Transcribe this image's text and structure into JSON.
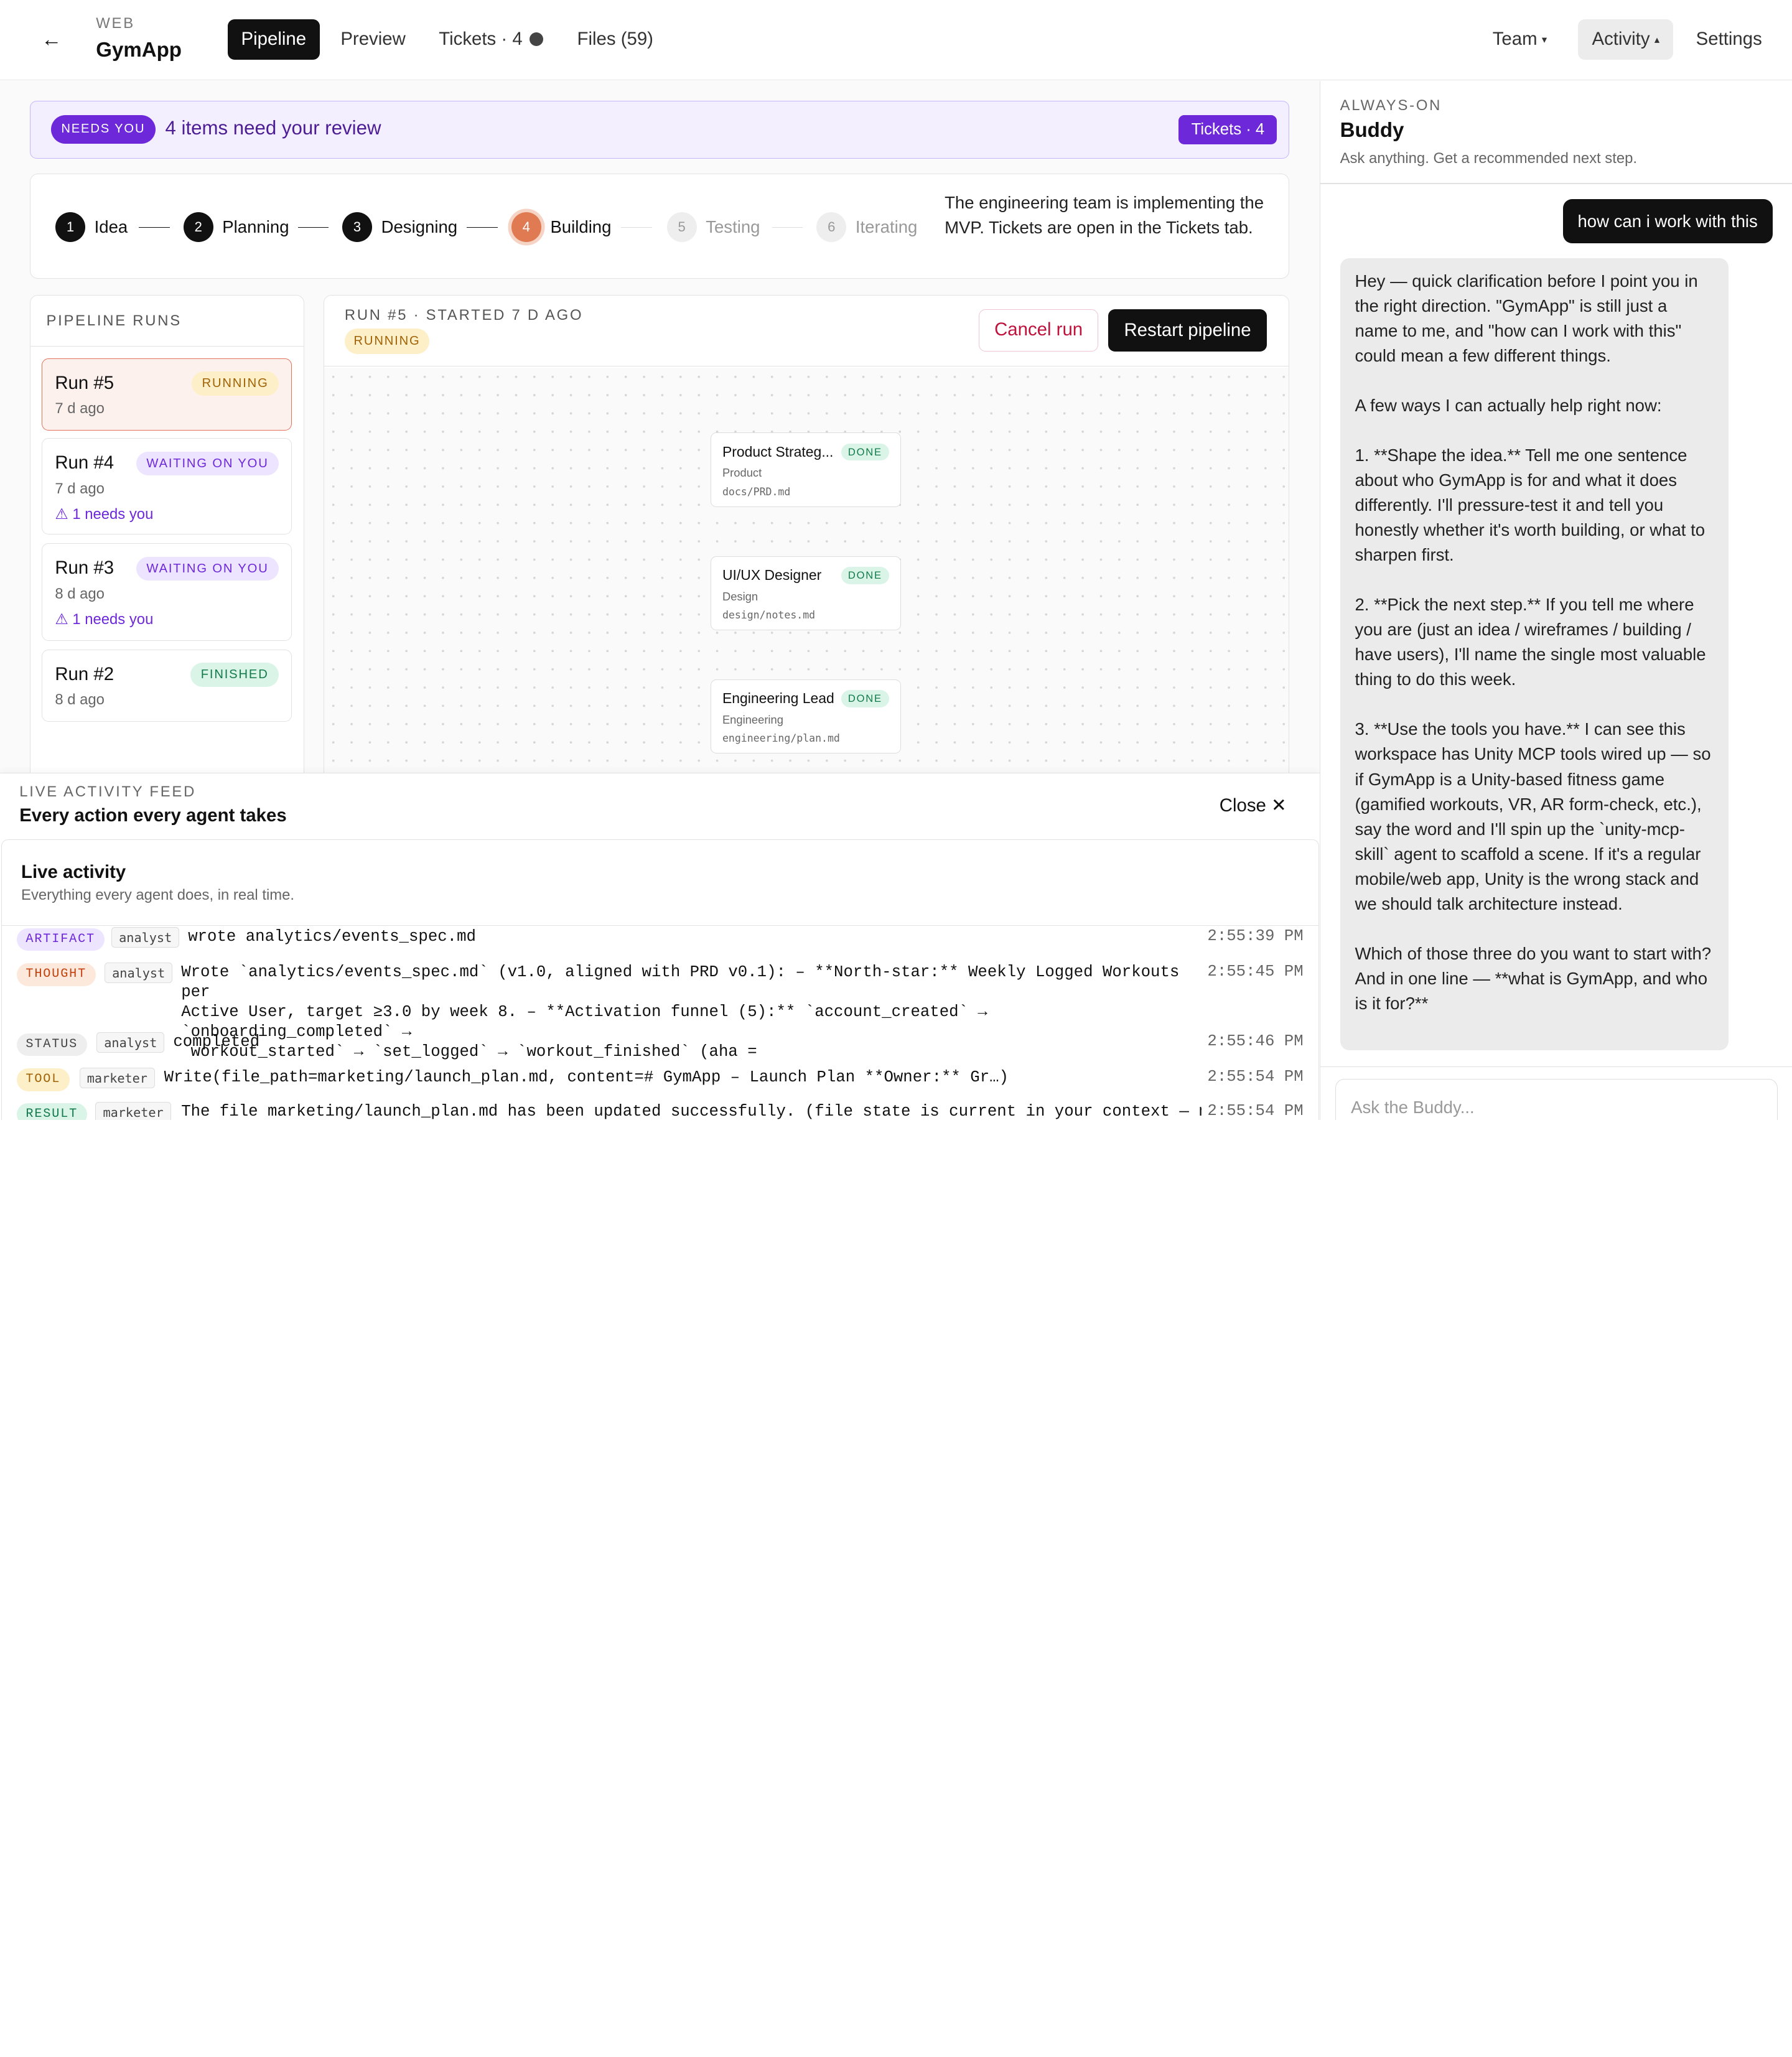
{
  "topbar": {
    "back_icon": "←",
    "app_kicker": "WEB",
    "app_name": "GymApp",
    "tabs": [
      {
        "label": "Pipeline",
        "active": true
      },
      {
        "label": "Preview"
      },
      {
        "label": "Tickets · 4"
      },
      {
        "label": "Files (59)"
      }
    ],
    "right": {
      "team": "Team",
      "team_caret": "▾",
      "activity": "Activity",
      "activity_caret": "▴",
      "settings": "Settings"
    }
  },
  "banner": {
    "badge": "NEEDS YOU",
    "text": "4 items need your review",
    "button": "Tickets · 4"
  },
  "stages": {
    "items": [
      {
        "num": "1",
        "label": "Idea"
      },
      {
        "num": "2",
        "label": "Planning"
      },
      {
        "num": "3",
        "label": "Designing"
      },
      {
        "num": "4",
        "label": "Building"
      },
      {
        "num": "5",
        "label": "Testing"
      },
      {
        "num": "6",
        "label": "Iterating"
      }
    ],
    "description": "The engineering team is implementing the MVP. Tickets are open in the Tickets tab."
  },
  "runs": {
    "title": "PIPELINE RUNS",
    "items": [
      {
        "name": "Run #5",
        "status": "RUNNING",
        "when": "7 d ago",
        "need": ""
      },
      {
        "name": "Run #4",
        "status": "WAITING ON YOU",
        "when": "7 d ago",
        "need": "⚠ 1 needs you"
      },
      {
        "name": "Run #3",
        "status": "WAITING ON YOU",
        "when": "8 d ago",
        "need": "⚠ 1 needs you"
      },
      {
        "name": "Run #2",
        "status": "FINISHED",
        "when": "8 d ago",
        "need": ""
      }
    ]
  },
  "canvas": {
    "meta": "RUN #5 · STARTED 7 D AGO",
    "status": "RUNNING",
    "cancel": "Cancel run",
    "restart": "Restart pipeline",
    "nodes": [
      {
        "title": "Product Strateg...",
        "badge": "DONE",
        "role": "Product",
        "file": "docs/PRD.md"
      },
      {
        "title": "UI/UX Designer",
        "badge": "DONE",
        "role": "Design",
        "file": "design/notes.md"
      },
      {
        "title": "Engineering Lead",
        "badge": "DONE",
        "role": "Engineering",
        "file": "engineering/plan.md"
      }
    ]
  },
  "feed": {
    "kicker": "LIVE ACTIVITY FEED",
    "title": "Every action every agent takes",
    "close": "Close",
    "close_icon": "✕",
    "live_title": "Live activity",
    "live_sub": "Everything every agent does, in real time.",
    "events": [
      {
        "type": "ARTIFACT",
        "agent": "analyst",
        "text": "wrote analytics/events_spec.md",
        "time": "2:55:39 PM"
      },
      {
        "type": "THOUGHT",
        "agent": "analyst",
        "text": "Wrote `analytics/events_spec.md` (v1.0, aligned with PRD v0.1): – **North-star:** Weekly Logged Workouts per\nActive User, target ≥3.0 by week 8. – **Activation funnel (5):** `account_created` → `onboarding_completed` →\n`workout_started` → `set_logged` → `workout_finished` (aha =",
        "time": "2:55:45 PM"
      },
      {
        "type": "STATUS",
        "agent": "analyst",
        "text": "completed",
        "time": "2:55:46 PM"
      },
      {
        "type": "TOOL",
        "agent": "marketer",
        "text": "Write(file_path=marketing/launch_plan.md, content=# GymApp – Launch Plan **Owner:** Gr…)",
        "time": "2:55:54 PM"
      },
      {
        "type": "RESULT",
        "agent": "marketer",
        "text": "The file marketing/launch_plan.md has been updated successfully. (file state is current in your context — no need",
        "time": "2:55:54 PM"
      }
    ]
  },
  "buddy": {
    "kicker": "ALWAYS-ON",
    "title": "Buddy",
    "subtitle": "Ask anything. Get a recommended next step.",
    "user_message": "how can i work with this",
    "assistant_message": "Hey — quick clarification before I point you in the right direction. \"GymApp\" is still just a name to me, and \"how can I work with this\" could mean a few different things.\n\nA few ways I can actually help right now:\n\n1. **Shape the idea.** Tell me one sentence about who GymApp is for and what it does differently. I'll pressure-test it and tell you honestly whether it's worth building, or what to sharpen first.\n\n2. **Pick the next step.** If you tell me where you are (just an idea / wireframes / building / have users), I'll name the single most valuable thing to do this week.\n\n3. **Use the tools you have.** I can see this workspace has Unity MCP tools wired up — so if GymApp is a Unity-based fitness game (gamified workouts, VR, AR form-check, etc.), say the word and I'll spin up the `unity-mcp-skill` agent to scaffold a scene. If it's a regular mobile/web app, Unity is the wrong stack and we should talk architecture instead.\n\nWhich of those three do you want to start with? And in one line — **what is GymApp, and who is it for?**",
    "input_placeholder": "Ask the Buddy..."
  },
  "colors": {
    "accent": "#6d28d9",
    "current_stage": "#e07a52",
    "primary": "#111111",
    "danger": "#be123c"
  }
}
